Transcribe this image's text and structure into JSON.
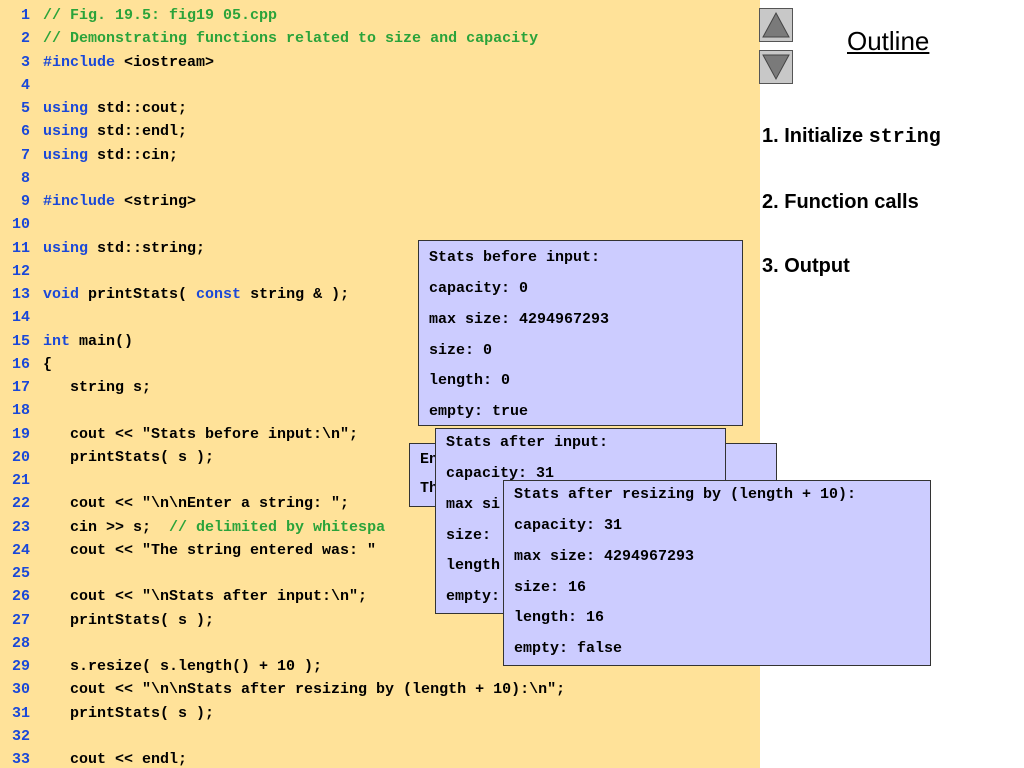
{
  "code": {
    "lines": [
      {
        "n": "1",
        "parts": [
          {
            "t": "// Fig. 19.5: fig19 05.cpp",
            "c": "cm"
          }
        ]
      },
      {
        "n": "2",
        "parts": [
          {
            "t": "// Demonstrating functions related to size and capacity",
            "c": "cm"
          }
        ]
      },
      {
        "n": "3",
        "parts": [
          {
            "t": "#include",
            "c": "kw"
          },
          {
            "t": " <iostream>",
            "c": "tx"
          }
        ]
      },
      {
        "n": "4",
        "parts": []
      },
      {
        "n": "5",
        "parts": [
          {
            "t": "using",
            "c": "kw"
          },
          {
            "t": " std::cout;",
            "c": "tx"
          }
        ]
      },
      {
        "n": "6",
        "parts": [
          {
            "t": "using",
            "c": "kw"
          },
          {
            "t": " std::endl;",
            "c": "tx"
          }
        ]
      },
      {
        "n": "7",
        "parts": [
          {
            "t": "using",
            "c": "kw"
          },
          {
            "t": " std::cin;",
            "c": "tx"
          }
        ]
      },
      {
        "n": "8",
        "parts": []
      },
      {
        "n": "9",
        "parts": [
          {
            "t": "#include",
            "c": "kw"
          },
          {
            "t": " <string>",
            "c": "tx"
          }
        ]
      },
      {
        "n": "10",
        "parts": []
      },
      {
        "n": "11",
        "parts": [
          {
            "t": "using",
            "c": "kw"
          },
          {
            "t": " std::string;",
            "c": "tx"
          }
        ]
      },
      {
        "n": "12",
        "parts": []
      },
      {
        "n": "13",
        "parts": [
          {
            "t": "void",
            "c": "kw"
          },
          {
            "t": " printStats( ",
            "c": "tx"
          },
          {
            "t": "const",
            "c": "kw"
          },
          {
            "t": " string & );",
            "c": "tx"
          }
        ]
      },
      {
        "n": "14",
        "parts": []
      },
      {
        "n": "15",
        "parts": [
          {
            "t": "int",
            "c": "kw"
          },
          {
            "t": " main()",
            "c": "tx"
          }
        ]
      },
      {
        "n": "16",
        "parts": [
          {
            "t": "{",
            "c": "tx"
          }
        ]
      },
      {
        "n": "17",
        "parts": [
          {
            "t": "   string s;",
            "c": "tx"
          }
        ]
      },
      {
        "n": "18",
        "parts": []
      },
      {
        "n": "19",
        "parts": [
          {
            "t": "   cout << \"Stats before input:\\n\";",
            "c": "tx"
          }
        ]
      },
      {
        "n": "20",
        "parts": [
          {
            "t": "   printStats( s );",
            "c": "tx"
          }
        ]
      },
      {
        "n": "21",
        "parts": []
      },
      {
        "n": "22",
        "parts": [
          {
            "t": "   cout << \"\\n\\nEnter a string: \";",
            "c": "tx"
          }
        ]
      },
      {
        "n": "23",
        "parts": [
          {
            "t": "   cin >> s;  ",
            "c": "tx"
          },
          {
            "t": "// delimited by whitespa",
            "c": "cm"
          }
        ]
      },
      {
        "n": "24",
        "parts": [
          {
            "t": "   cout << \"The string entered was: \"",
            "c": "tx"
          }
        ]
      },
      {
        "n": "25",
        "parts": []
      },
      {
        "n": "26",
        "parts": [
          {
            "t": "   cout << \"\\nStats after input:\\n\";",
            "c": "tx"
          }
        ]
      },
      {
        "n": "27",
        "parts": [
          {
            "t": "   printStats( s );",
            "c": "tx"
          }
        ]
      },
      {
        "n": "28",
        "parts": []
      },
      {
        "n": "29",
        "parts": [
          {
            "t": "   s.resize( s.length() + 10 );",
            "c": "tx"
          }
        ]
      },
      {
        "n": "30",
        "parts": [
          {
            "t": "   cout << \"\\n\\nStats after resizing by (length + 10):\\n\";",
            "c": "tx"
          }
        ]
      },
      {
        "n": "31",
        "parts": [
          {
            "t": "   printStats( s );",
            "c": "tx"
          }
        ]
      },
      {
        "n": "32",
        "parts": []
      },
      {
        "n": "33",
        "parts": [
          {
            "t": "   cout << endl;",
            "c": "tx"
          }
        ]
      }
    ]
  },
  "output_boxes": [
    {
      "lines": [
        "Stats before input:",
        "capacity: 0",
        "max size: 4294967293",
        "size: 0",
        "length: 0",
        "empty: true"
      ]
    },
    {
      "lines": [
        "En",
        "Th"
      ]
    },
    {
      "lines": [
        "Stats after input:",
        "capacity: 31",
        "max si",
        "size:",
        "length",
        "empty:"
      ]
    },
    {
      "lines": [
        "Stats after resizing by (length + 10):",
        "capacity: 31",
        "max size: 4294967293",
        "size: 16",
        "length: 16",
        "empty: false"
      ]
    }
  ],
  "nav": {
    "up_icon": "triangle-up-icon",
    "down_icon": "triangle-down-icon"
  },
  "outline": {
    "title": "Outline",
    "items": [
      {
        "label": "1. Initialize ",
        "code": "string"
      },
      {
        "label": "2. Function calls",
        "code": ""
      },
      {
        "label": "3. Output",
        "code": ""
      }
    ]
  },
  "colors": {
    "code_bg": "#ffe299",
    "output_bg": "#ccccff",
    "keyword": "#1a48d8",
    "comment": "#2aa33a",
    "line_number": "#1a48d8"
  }
}
